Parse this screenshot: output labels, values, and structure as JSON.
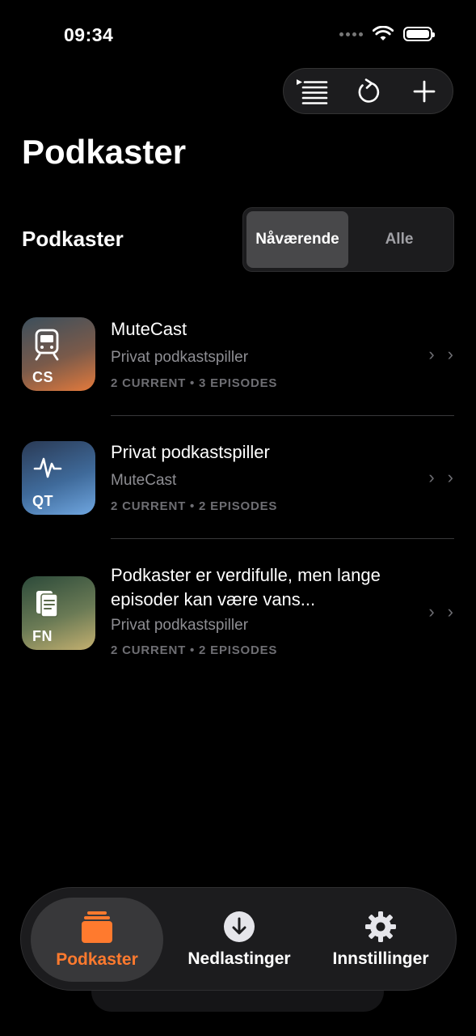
{
  "status": {
    "time": "09:34"
  },
  "toolbar": {
    "queue_icon": "list-queue-icon",
    "refresh_icon": "refresh-icon",
    "add_icon": "plus-icon"
  },
  "page": {
    "title": "Podkaster"
  },
  "section": {
    "label": "Podkaster",
    "segments": [
      "Nåværende",
      "Alle"
    ],
    "selected": "Nåværende"
  },
  "podcasts": [
    {
      "code": "CS",
      "icon": "train-icon",
      "title": "MuteCast",
      "subtitle": "Privat podkastspiller",
      "meta": "2 CURRENT • 3 EPISODES"
    },
    {
      "code": "QT",
      "icon": "heartbeat-icon",
      "title": "Privat podkastspiller",
      "subtitle": "MuteCast",
      "meta": "2 CURRENT • 2 EPISODES"
    },
    {
      "code": "FN",
      "icon": "document-icon",
      "title": "Podkaster er verdifulle, men lange episoder kan være vans...",
      "subtitle": "Privat podkastspiller",
      "meta": "2 CURRENT • 2 EPISODES"
    }
  ],
  "tabs": [
    {
      "label": "Podkaster",
      "icon": "stack-icon"
    },
    {
      "label": "Nedlastinger",
      "icon": "download-icon"
    },
    {
      "label": "Innstillinger",
      "icon": "gear-icon"
    }
  ],
  "colors": {
    "accent": "#ff7a2e",
    "background": "#000000"
  }
}
